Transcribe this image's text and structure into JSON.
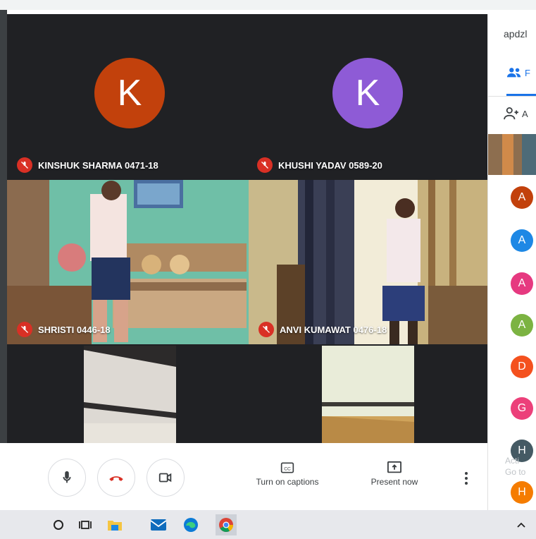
{
  "meeting": {
    "participants": [
      {
        "name": "KINSHUK SHARMA 0471-18",
        "initial": "K",
        "avatar_color": "#c2410c"
      },
      {
        "name": "KHUSHI YADAV 0589-20",
        "initial": "K",
        "avatar_color": "#8e5bd6"
      },
      {
        "name": "SHRISTI 0446-18"
      },
      {
        "name": "ANVI KUMAWAT 0476-18"
      }
    ]
  },
  "controls": {
    "captions_label": "Turn on captions",
    "present_label": "Present now",
    "end_call_color": "#d93025"
  },
  "sidebar": {
    "meeting_code": "apdzl",
    "tab_people_label": "F",
    "add_people_label": "A",
    "participant_avatars": [
      {
        "initial": "A",
        "color": "#c2410c"
      },
      {
        "initial": "A",
        "color": "#1e88e5"
      },
      {
        "initial": "A",
        "color": "#e63980"
      },
      {
        "initial": "A",
        "color": "#7cb342"
      },
      {
        "initial": "D",
        "color": "#f4511e"
      },
      {
        "initial": "G",
        "color": "#ec407a"
      },
      {
        "initial": "H",
        "color": "#455a64"
      },
      {
        "initial": "H",
        "color": "#f57c00"
      }
    ],
    "watermark_line1": "Acti",
    "watermark_line2": "Go to"
  },
  "taskbar": {
    "icons": [
      "search-icon",
      "task-view-icon",
      "file-explorer-icon",
      "mail-icon",
      "edge-icon",
      "chrome-icon"
    ]
  }
}
